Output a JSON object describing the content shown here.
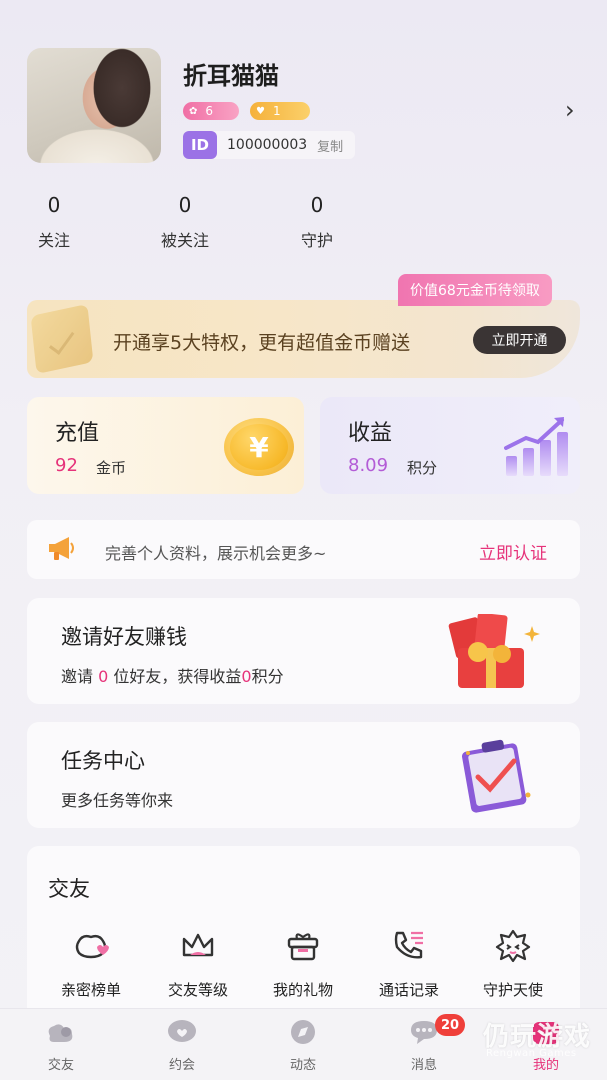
{
  "profile": {
    "name": "折耳猫猫",
    "level_badge": "6",
    "guard_badge": "1",
    "id_tag": "ID",
    "id_value": "100000003",
    "copy_label": "复制"
  },
  "stats": [
    {
      "value": "0",
      "label": "关注"
    },
    {
      "value": "0",
      "label": "被关注"
    },
    {
      "value": "0",
      "label": "守护"
    }
  ],
  "vip": {
    "tip": "价值68元金币待领取",
    "text": "开通享5大特权，更有超值金币赠送",
    "button": "立即开通"
  },
  "recharge": {
    "title": "充值",
    "value": "92",
    "unit": "金币",
    "coin_symbol": "¥"
  },
  "income": {
    "title": "收益",
    "value": "8.09",
    "unit": "积分"
  },
  "notice": {
    "text": "完善个人资料，展示机会更多~",
    "link": "立即认证"
  },
  "invite": {
    "title": "邀请好友赚钱",
    "sub_prefix": "邀请 ",
    "friends": "0",
    "sub_middle": " 位好友，获得收益",
    "earnings": "0",
    "sub_suffix": "积分"
  },
  "task": {
    "title": "任务中心",
    "sub": "更多任务等你来"
  },
  "social": {
    "title": "交友",
    "items": [
      {
        "label": "亲密榜单",
        "icon": "heart-chat-icon"
      },
      {
        "label": "交友等级",
        "icon": "crown-icon"
      },
      {
        "label": "我的礼物",
        "icon": "gift-box-icon"
      },
      {
        "label": "通话记录",
        "icon": "phone-log-icon"
      },
      {
        "label": "守护天使",
        "icon": "angel-face-icon"
      }
    ]
  },
  "bottom_nav": {
    "items": [
      {
        "label": "交友",
        "icon": "friends-icon"
      },
      {
        "label": "约会",
        "icon": "date-chat-icon"
      },
      {
        "label": "动态",
        "icon": "compass-icon"
      },
      {
        "label": "消息",
        "icon": "message-icon"
      },
      {
        "label": "我的",
        "icon": "profile-icon"
      }
    ],
    "message_count": "20",
    "active": "我的"
  },
  "watermark": {
    "title": "仍玩游戏",
    "sub": "Rengwan Games"
  },
  "colors": {
    "accent": "#e6337a",
    "purple": "#9b72e6",
    "gold": "#f7b92a"
  }
}
